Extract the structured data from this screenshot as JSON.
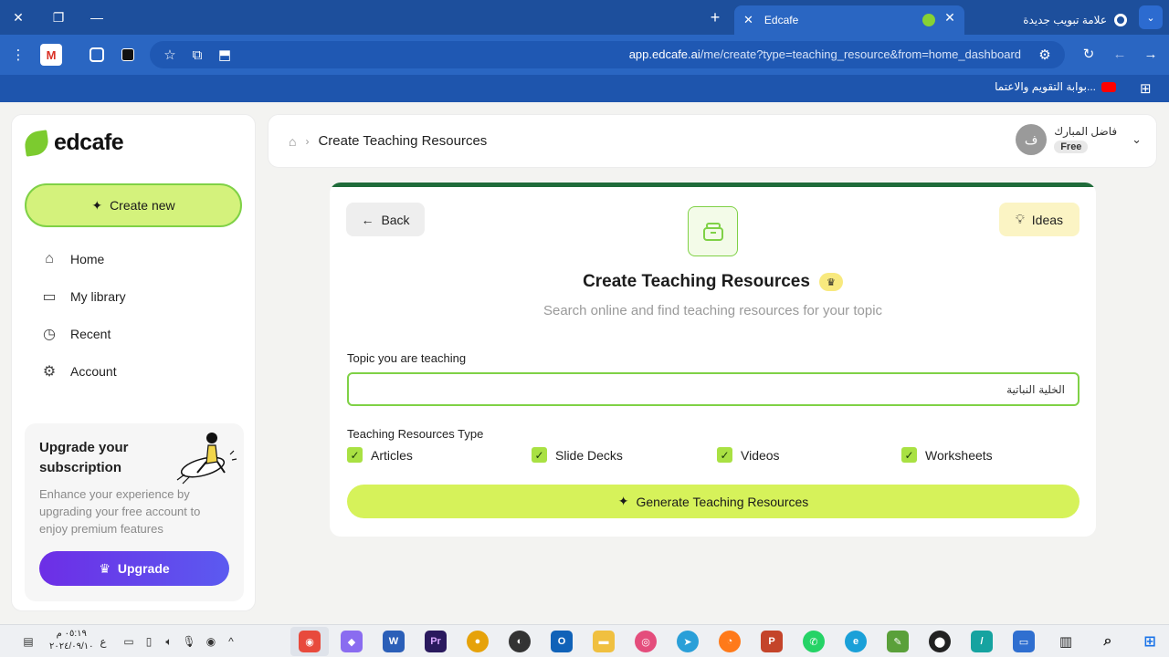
{
  "browser": {
    "active_tab_title": "Edcafe",
    "inactive_tab_title": "علامة تبويب جديدة",
    "url_host": "app.edcafe.ai",
    "url_path": "/me/create?type=teaching_resource&from=home_dashboard",
    "bookmark_label": "بوابة التقويم والاعتما..."
  },
  "sidebar": {
    "logo_text": "edcafe",
    "create_new_label": "Create new",
    "nav": [
      {
        "label": "Home",
        "icon": "home-icon"
      },
      {
        "label": "My library",
        "icon": "library-icon"
      },
      {
        "label": "Recent",
        "icon": "clock-icon"
      },
      {
        "label": "Account",
        "icon": "gear-icon"
      }
    ],
    "upgrade": {
      "title": "Upgrade your subscription",
      "description": "Enhance your experience by upgrading your free account to enjoy premium features",
      "button_label": "Upgrade"
    }
  },
  "header": {
    "breadcrumb_title": "Create Teaching Resources",
    "user_name": "فاضل المبارك",
    "avatar_initial": "ف",
    "plan": "Free"
  },
  "main": {
    "back_label": "Back",
    "ideas_label": "Ideas",
    "title": "Create Teaching Resources",
    "subtitle": "Search online and find teaching resources for your topic",
    "topic_label": "Topic you are teaching",
    "topic_value": "الخلية النباتية",
    "types_label": "Teaching Resources Type",
    "types": [
      {
        "label": "Articles",
        "checked": true
      },
      {
        "label": "Slide Decks",
        "checked": true
      },
      {
        "label": "Videos",
        "checked": true
      },
      {
        "label": "Worksheets",
        "checked": true
      }
    ],
    "generate_label": "Generate Teaching Resources"
  },
  "taskbar": {
    "time": "٠٥:١٩ م",
    "date": "٢٠٢٤/٠٩/١٠",
    "lang": "ع"
  },
  "colors": {
    "accent_green": "#7fd146",
    "lime_button": "#d6f25a",
    "upgrade_purple": "#6d2ee6",
    "browser_blue": "#2a66c2"
  }
}
